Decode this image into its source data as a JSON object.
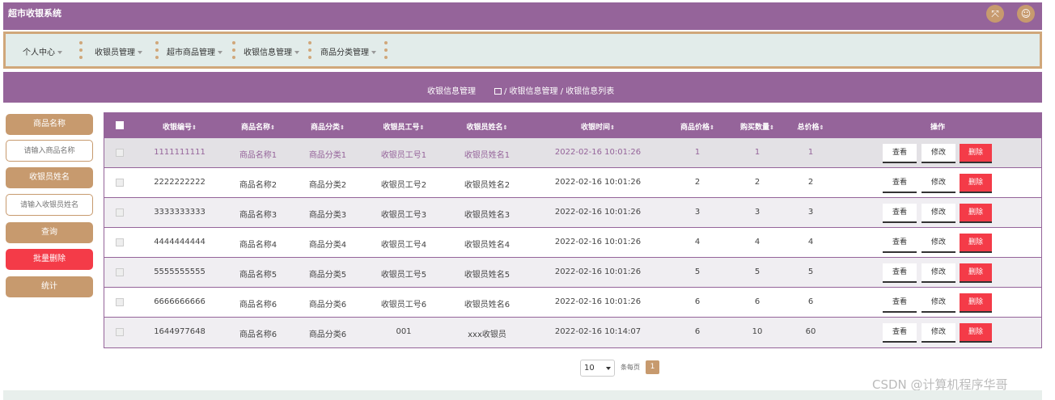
{
  "header": {
    "title": "超市收银系统",
    "icons": [
      "fullscreen-icon",
      "user-icon"
    ]
  },
  "menu": {
    "items": [
      {
        "label": "个人中心"
      },
      {
        "label": "收银员管理"
      },
      {
        "label": "超市商品管理"
      },
      {
        "label": "收银信息管理"
      },
      {
        "label": "商品分类管理"
      }
    ]
  },
  "breadcrumb": {
    "title": "收银信息管理",
    "path": "/ 收银信息管理 / 收银信息列表"
  },
  "search": {
    "product_name_label": "商品名称",
    "product_name_placeholder": "请输入商品名称",
    "cashier_name_label": "收银员姓名",
    "cashier_name_placeholder": "请输入收银员姓名",
    "query_label": "查询",
    "batch_delete_label": "批量删除",
    "stats_label": "统计"
  },
  "table": {
    "columns": [
      "收银编号",
      "商品名称",
      "商品分类",
      "收银员工号",
      "收银员姓名",
      "收银时间",
      "商品价格",
      "购买数量",
      "总价格",
      "操作"
    ],
    "actions": {
      "view": "查看",
      "edit": "修改",
      "delete": "删除"
    },
    "rows": [
      {
        "id": "1111111111",
        "product": "商品名称1",
        "category": "商品分类1",
        "cashier_no": "收银员工号1",
        "cashier_name": "收银员姓名1",
        "time": "2022-02-16 10:01:26",
        "price": "1",
        "qty": "1",
        "total": "1"
      },
      {
        "id": "2222222222",
        "product": "商品名称2",
        "category": "商品分类2",
        "cashier_no": "收银员工号2",
        "cashier_name": "收银员姓名2",
        "time": "2022-02-16 10:01:26",
        "price": "2",
        "qty": "2",
        "total": "2"
      },
      {
        "id": "3333333333",
        "product": "商品名称3",
        "category": "商品分类3",
        "cashier_no": "收银员工号3",
        "cashier_name": "收银员姓名3",
        "time": "2022-02-16 10:01:26",
        "price": "3",
        "qty": "3",
        "total": "3"
      },
      {
        "id": "4444444444",
        "product": "商品名称4",
        "category": "商品分类4",
        "cashier_no": "收银员工号4",
        "cashier_name": "收银员姓名4",
        "time": "2022-02-16 10:01:26",
        "price": "4",
        "qty": "4",
        "total": "4"
      },
      {
        "id": "5555555555",
        "product": "商品名称5",
        "category": "商品分类5",
        "cashier_no": "收银员工号5",
        "cashier_name": "收银员姓名5",
        "time": "2022-02-16 10:01:26",
        "price": "5",
        "qty": "5",
        "total": "5"
      },
      {
        "id": "6666666666",
        "product": "商品名称6",
        "category": "商品分类6",
        "cashier_no": "收银员工号6",
        "cashier_name": "收银员姓名6",
        "time": "2022-02-16 10:01:26",
        "price": "6",
        "qty": "6",
        "total": "6"
      },
      {
        "id": "1644977648",
        "product": "商品名称6",
        "category": "商品分类6",
        "cashier_no": "001",
        "cashier_name": "xxx收银员",
        "time": "2022-02-16 10:14:07",
        "price": "6",
        "qty": "10",
        "total": "60"
      }
    ]
  },
  "pagination": {
    "page_size": "10",
    "page_size_label": "条每页",
    "current_page": "1"
  },
  "watermark": "CSDN @计算机程序华哥",
  "colors": {
    "primary": "#95649a",
    "accent": "#c79a6e",
    "danger": "#f43b48",
    "menu_bg": "#e2ecea"
  }
}
